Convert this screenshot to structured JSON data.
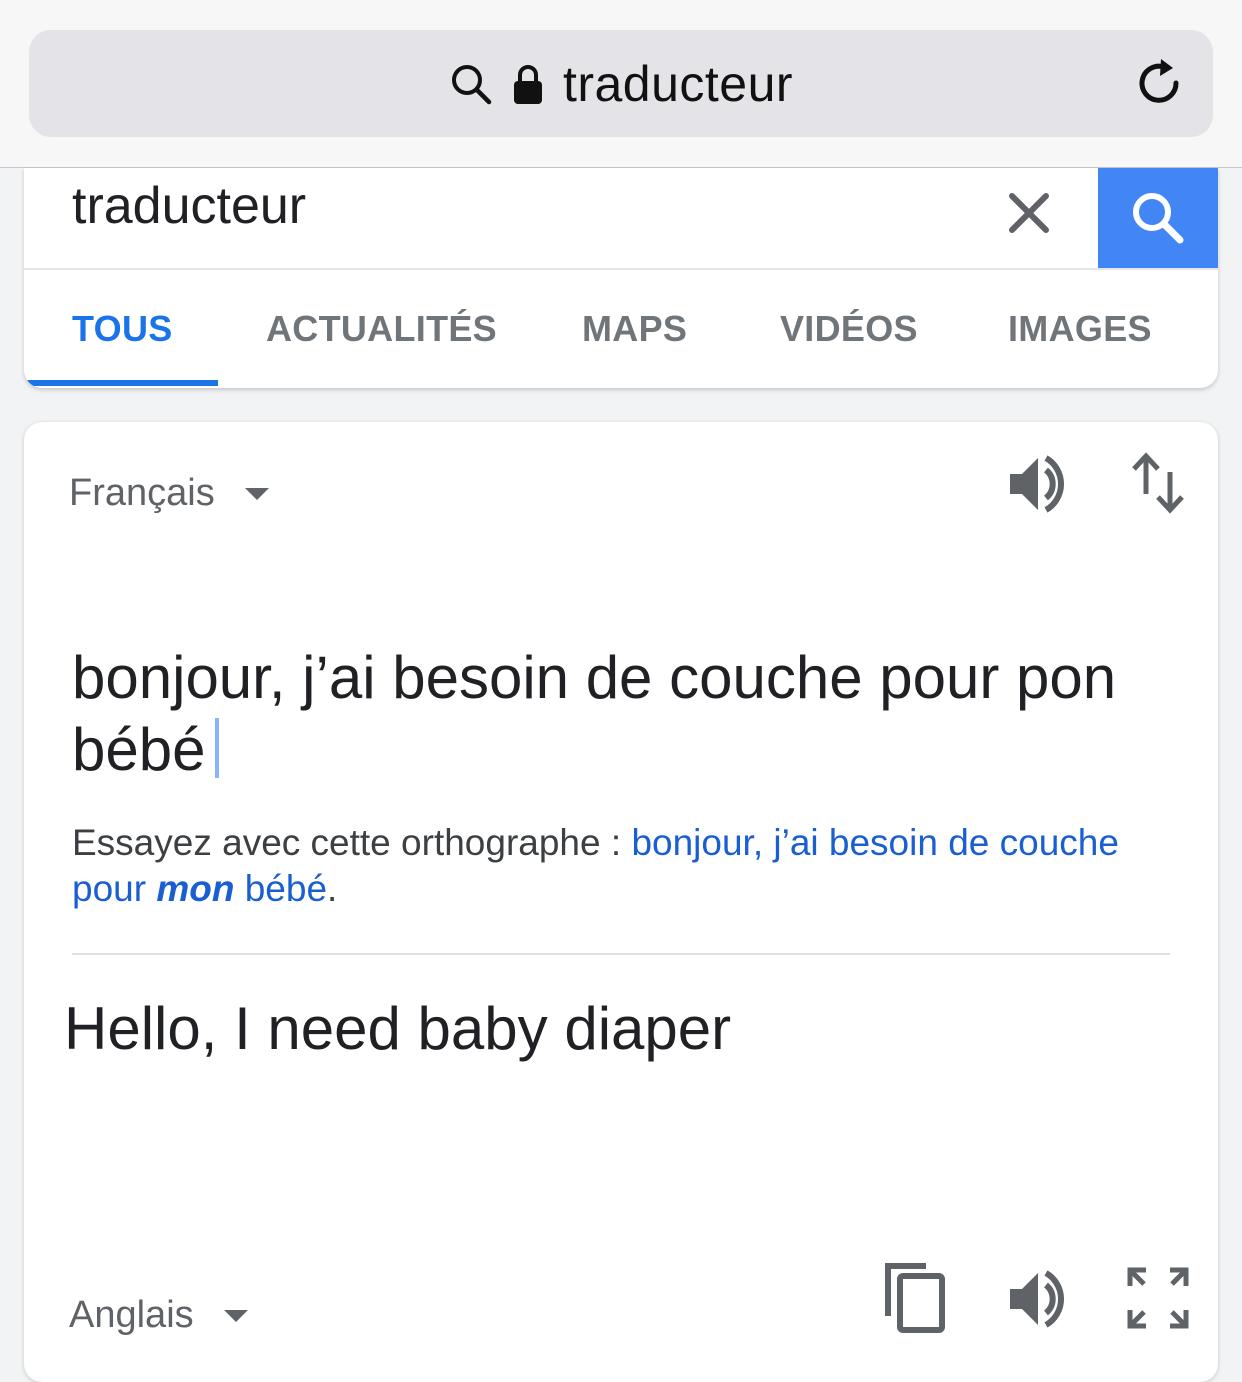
{
  "browser": {
    "url_text": "traducteur",
    "icons": [
      "search-icon",
      "lock-icon",
      "reload-icon"
    ]
  },
  "search": {
    "query": "traducteur",
    "clear_icon": "close-icon",
    "submit_icon": "search-icon",
    "accent": "#4285f4"
  },
  "tabs": [
    {
      "label": "TOUS",
      "active": true
    },
    {
      "label": "ACTUALITÉS",
      "active": false
    },
    {
      "label": "MAPS",
      "active": false
    },
    {
      "label": "VIDÉOS",
      "active": false
    },
    {
      "label": "IMAGES",
      "active": false
    }
  ],
  "translator": {
    "source_lang": "Français",
    "target_lang": "Anglais",
    "source_text": "bonjour, j’ai besoin de couche pour pon bébé",
    "suggestion": {
      "prefix": "Essayez avec cette orthographe : ",
      "link_before": "bonjour, j’ai besoin de couche pour ",
      "link_correction": "mon",
      "link_after": " bébé",
      "suffix": "."
    },
    "translated_text": "Hello, I need baby diaper",
    "source_icons": [
      "speaker-icon",
      "swap-icon"
    ],
    "target_icons": [
      "copy-icon",
      "speaker-icon",
      "fullscreen-icon"
    ]
  },
  "colors": {
    "link": "#1a5fd1",
    "active_tab": "#1a73e8",
    "cursor": "#8ab4f8"
  }
}
